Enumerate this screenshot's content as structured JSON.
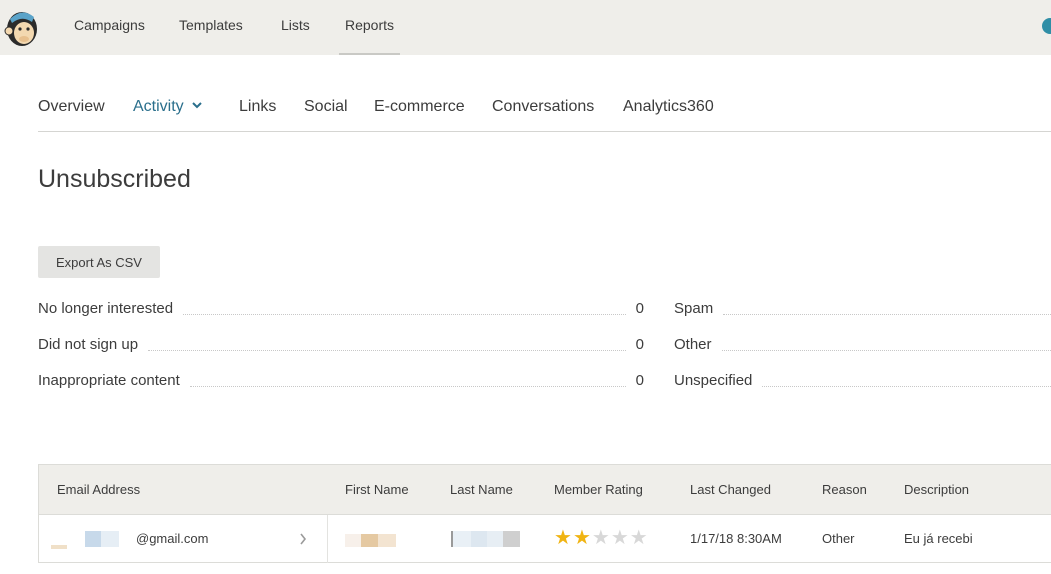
{
  "app": {
    "top_nav": [
      "Campaigns",
      "Templates",
      "Lists",
      "Reports"
    ],
    "active_top_nav": "Reports"
  },
  "report_nav": {
    "items": [
      "Overview",
      "Activity",
      "Links",
      "Social",
      "E-commerce",
      "Conversations",
      "Analytics360"
    ],
    "active": "Activity"
  },
  "page": {
    "title": "Unsubscribed",
    "export_label": "Export As CSV"
  },
  "stats": {
    "left": [
      {
        "label": "No longer interested",
        "count": "0"
      },
      {
        "label": "Did not sign up",
        "count": "0"
      },
      {
        "label": "Inappropriate content",
        "count": "0"
      }
    ],
    "right": [
      {
        "label": "Spam"
      },
      {
        "label": "Other"
      },
      {
        "label": "Unspecified"
      }
    ]
  },
  "table": {
    "columns": [
      "Email Address",
      "First Name",
      "Last Name",
      "Member Rating",
      "Last Changed",
      "Reason",
      "Description"
    ],
    "rows": [
      {
        "email_visible": "@gmail.com",
        "member_rating": 2,
        "member_rating_max": 5,
        "last_changed": "1/17/18 8:30AM",
        "reason": "Other",
        "description": "Eu já recebi"
      }
    ]
  },
  "colors": {
    "accent": "#2a6f8c",
    "star_filled": "#f0b413",
    "star_empty": "#d8d8d8",
    "topbar_bg": "#efeeea"
  }
}
